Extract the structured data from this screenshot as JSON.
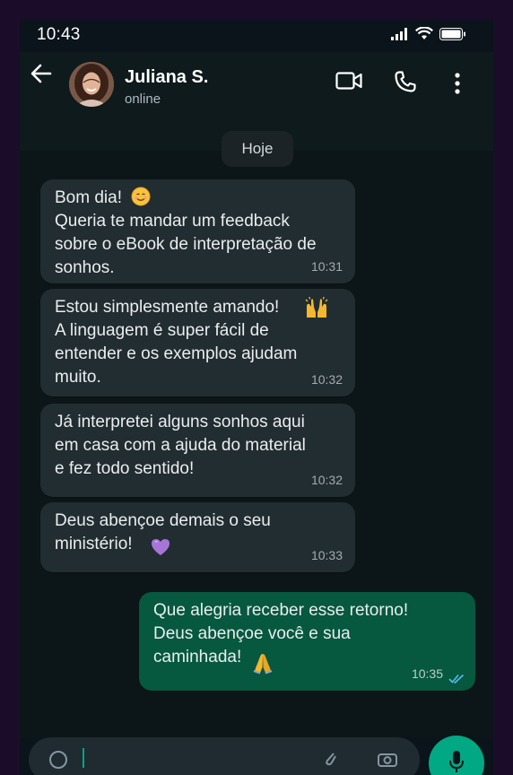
{
  "status_bar": {
    "time": "10:43"
  },
  "header": {
    "contact_name": "Juliana S.",
    "contact_status": "online"
  },
  "date_chip": "Hoje",
  "messages": [
    {
      "direction": "in",
      "text": "Bom dia! \nQueria te mandar um feedback\nsobre o eBook de interpretação de\nsonhos.",
      "emoji": "smiling-face-icon",
      "time": "10:31"
    },
    {
      "direction": "in",
      "text": "Estou simplesmente amando! \nA linguagem é super fácil de\nentender e os exemplos ajudam\nmuito.",
      "emoji": "raising-hands-icon",
      "time": "10:32"
    },
    {
      "direction": "in",
      "text": "Já interpretei alguns sonhos aqui\nem casa com a ajuda do material\ne fez todo sentido!",
      "time": "10:32"
    },
    {
      "direction": "in",
      "text": "Deus abençoe demais o seu\nministério! ",
      "emoji": "purple-heart-icon",
      "time": "10:33"
    },
    {
      "direction": "out",
      "text": "Que alegria receber esse retorno!\nDeus abençoe você e sua\ncaminhada! ",
      "emoji": "folded-hands-icon",
      "time": "10:35",
      "read": true
    }
  ],
  "colors": {
    "background": "#0c1618",
    "incoming_bubble": "#222d31",
    "outgoing_bubble": "#06583f",
    "read_ticks": "#53bdeb",
    "accent": "#00a884"
  }
}
